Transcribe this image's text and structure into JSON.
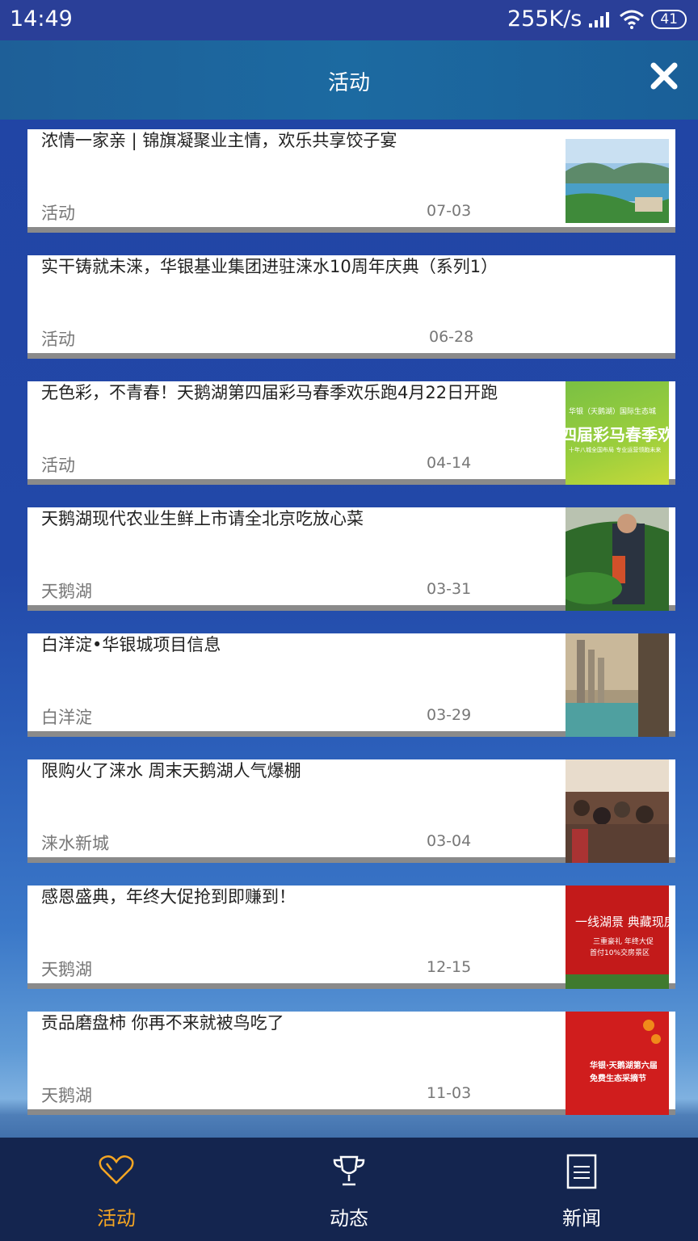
{
  "status_bar": {
    "time": "14:49",
    "network_speed": "255K/s",
    "battery": "41"
  },
  "header": {
    "title": "活动",
    "close_icon": "close-icon"
  },
  "articles": [
    {
      "title": "浓情一家亲 | 锦旗凝聚业主情，欢乐共享饺子宴",
      "category": "活动",
      "date": "07-03",
      "has_image": true
    },
    {
      "title": "实干铸就未涞，华银基业集团进驻涞水10周年庆典（系列1）",
      "category": "活动",
      "date": "06-28",
      "has_image": false
    },
    {
      "title": "无色彩，不青春！天鹅湖第四届彩马春季欢乐跑4月22日开跑",
      "category": "活动",
      "date": "04-14",
      "has_image": true,
      "image_text": {
        "line1": "华银（天鹅湖）国际生态城",
        "line2": "四届彩马春季欢乐",
        "line3": "十年八城全国布局 专业运营领跑未来"
      }
    },
    {
      "title": "天鹅湖现代农业生鲜上市请全北京吃放心菜",
      "category": "天鹅湖",
      "date": "03-31",
      "has_image": true
    },
    {
      "title": "白洋淀•华银城项目信息",
      "category": "白洋淀",
      "date": "03-29",
      "has_image": true
    },
    {
      "title": "限购火了涞水 周末天鹅湖人气爆棚",
      "category": "涞水新城",
      "date": "03-04",
      "has_image": true
    },
    {
      "title": "感恩盛典，年终大促抢到即赚到！",
      "category": "天鹅湖",
      "date": "12-15",
      "has_image": true,
      "image_text": {
        "line1": "一线湖景 典藏现房",
        "line2": "三重豪礼 年终大促",
        "line3": "首付10%交房景区"
      }
    },
    {
      "title": "贡品磨盘柿 你再不来就被鸟吃了",
      "category": "天鹅湖",
      "date": "11-03",
      "has_image": true,
      "image_text": {
        "line1": "华银·天鹅湖第六届",
        "line2": "免费生态采摘节"
      }
    }
  ],
  "tabs": [
    {
      "label": "活动",
      "icon": "heart-icon",
      "active": true
    },
    {
      "label": "动态",
      "icon": "trophy-icon",
      "active": false
    },
    {
      "label": "新闻",
      "icon": "document-icon",
      "active": false
    }
  ],
  "colors": {
    "accent": "#f5a623",
    "header": "#1c6aa1",
    "tabbar": "#14254f"
  }
}
